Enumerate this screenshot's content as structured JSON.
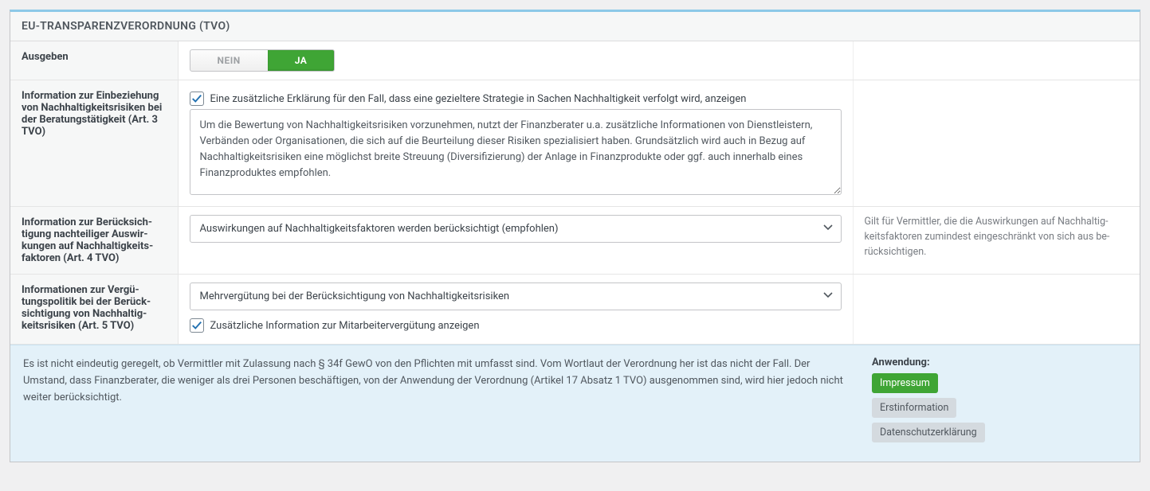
{
  "header": {
    "title": "EU-Transparenzverordnung (TVO)"
  },
  "row_output": {
    "label": "Ausgeben",
    "no_label": "NEIN",
    "yes_label": "JA"
  },
  "row_art3": {
    "label": "Information zur Einbeziehung von Nachhaltigkeitsrisiken bei der Beratungstätigkeit (Art. 3 TVO)",
    "checkbox_label": "Eine zusätzliche Erklärung für den Fall, dass eine gezieltere Strategie in Sachen Nachhaltigkeit verfolgt wird, anzeigen",
    "textarea_value": "Um die Bewertung von Nachhaltigkeitsrisiken vorzunehmen, nutzt der Finanzberater u.a. zusätzliche Informationen von Dienstleistern, Verbänden oder Organisationen, die sich auf die Beurteilung dieser Risiken spezialisiert haben. Grundsätzlich wird auch in Bezug auf Nachhaltigkeitsrisiken eine möglichst breite Streuung (Diversifizierung) der Anlage in Finanzprodukte oder ggf. auch innerhalb eines Finanzproduktes empfohlen."
  },
  "row_art4": {
    "label": "Information zur Berücksich­tigung nachteiliger Auswir­kungen auf Nachhaltigkeits­faktoren (Art. 4 TVO)",
    "select_value": "Auswirkungen auf Nachhaltigkeitsfaktoren werden berücksichtigt (empfohlen)",
    "help_text": "Gilt für Vermittler, die die Auswirkungen auf Nachhaltig­keitsfaktoren zumindest eingeschränkt von sich aus be­rücksichtigen."
  },
  "row_art5": {
    "label": "Informationen zur Vergü­tungspolitik bei der Berück­sichtigung von Nachhaltig­keitsrisiken (Art. 5 TVO)",
    "select_value": "Mehrvergütung bei der Berücksichtigung von Nachhaltigkeitsrisiken",
    "checkbox_label": "Zusätzliche Information zur Mitarbeitervergütung anzeigen"
  },
  "footer": {
    "note_text": "Es ist nicht eindeutig geregelt, ob Vermittler mit Zulassung nach § 34f GewO von den Pflichten mit umfasst sind. Vom Wortlaut der Verordnung her ist das nicht der Fall. Der Umstand, dass Finanzberater, die weniger als drei Personen beschäftigen, von der Anwendung der Verordnung (Artikel 17 Absatz 1 TVO) ausgenommen sind, wird hier jedoch nicht weiter berücksichtigt.",
    "apps_title": "Anwendung:",
    "apps": [
      "Impressum",
      "Erstinformation",
      "Datenschutzerklärung"
    ]
  },
  "colors": {
    "accent_green": "#3fa535",
    "check_color": "#2271b1"
  }
}
